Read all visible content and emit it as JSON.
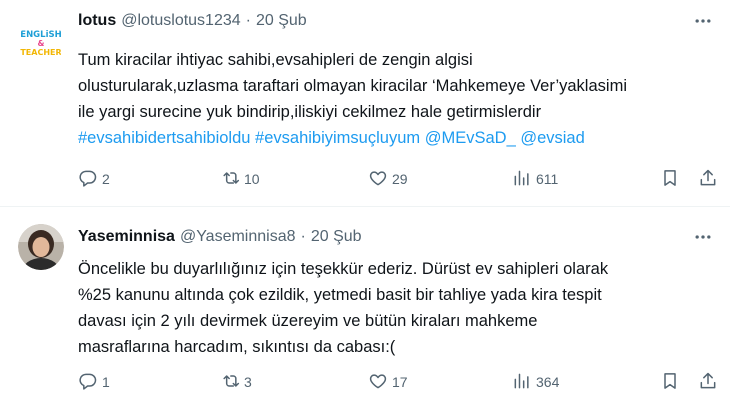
{
  "tweets": [
    {
      "name": "lotus",
      "handle": "@lotuslotus1234",
      "dot": "·",
      "date": "20 Şub",
      "avatar_text": [
        "ENGLiSH",
        "&",
        "TEACHER"
      ],
      "lines": [
        [
          {
            "text": "Tum kiracilar ihtiyac sahibi,evsahipleri de zengin algisi",
            "tag": false
          }
        ],
        [
          {
            "text": "olusturularak,uzlasma taraftari olmayan kiracilar ‘Mahkemeye Ver’yaklasimi",
            "tag": false
          }
        ],
        [
          {
            "text": "ile yargi surecine yuk bindirip,iliskiyi cekilmez hale getirmislerdir",
            "tag": false
          }
        ],
        [
          {
            "text": "#evsahibidertsahibioldu",
            "tag": true
          },
          {
            "text": " ",
            "tag": false
          },
          {
            "text": "#evsahibiyimsuçluyum",
            "tag": true
          },
          {
            "text": " ",
            "tag": false
          },
          {
            "text": "@MEvSaD_",
            "tag": true
          },
          {
            "text": " ",
            "tag": false
          },
          {
            "text": "@evsiad",
            "tag": true
          }
        ]
      ],
      "replies": "2",
      "retweets": "10",
      "likes": "29",
      "views": "611"
    },
    {
      "name": "Yaseminnisa",
      "handle": "@Yaseminnisa8",
      "dot": "·",
      "date": "20 Şub",
      "lines": [
        [
          {
            "text": "Öncelikle  bu duyarlılığınız  için  teşekkür ederiz.  Dürüst  ev sahipleri  olarak",
            "tag": false
          }
        ],
        [
          {
            "text": "%25  kanunu altında çok  ezildik, yetmedi  basit  bir tahliye yada kira  tespit",
            "tag": false
          }
        ],
        [
          {
            "text": "davası  için  2 yılı  devirmek  üzereyim  ve bütün  kiraları  mahkeme",
            "tag": false
          }
        ],
        [
          {
            "text": "masraflarına harcadım,  sıkıntısı da cabası:(",
            "tag": false
          }
        ]
      ],
      "replies": "1",
      "retweets": "3",
      "likes": "17",
      "views": "364"
    }
  ],
  "colors": {
    "text": "#0f1419",
    "muted": "#536471",
    "link": "#1d9bf0",
    "divider": "#eff3f4"
  },
  "icons": [
    "more-icon",
    "reply-icon",
    "retweet-icon",
    "like-icon",
    "views-icon",
    "bookmark-icon",
    "share-icon"
  ]
}
